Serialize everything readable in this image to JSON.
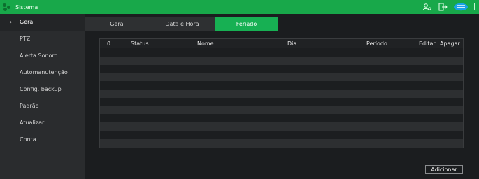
{
  "window": {
    "title": "Sistema"
  },
  "sidebar": {
    "items": [
      {
        "label": "Geral",
        "active": true
      },
      {
        "label": "PTZ",
        "active": false
      },
      {
        "label": "Alerta Sonoro",
        "active": false
      },
      {
        "label": "Automanutenção",
        "active": false
      },
      {
        "label": "Config. backup",
        "active": false
      },
      {
        "label": "Padrão",
        "active": false
      },
      {
        "label": "Atualizar",
        "active": false
      },
      {
        "label": "Conta",
        "active": false
      }
    ],
    "chevron": "›"
  },
  "tabs": [
    {
      "label": "Geral",
      "active": false
    },
    {
      "label": "Data e Hora",
      "active": false
    },
    {
      "label": "Feriado",
      "active": true
    }
  ],
  "table": {
    "columns": [
      "0",
      "Status",
      "Nome",
      "Dia",
      "Período",
      "Editar",
      "Apagar"
    ],
    "rows": []
  },
  "buttons": {
    "add": "Adicionar"
  },
  "colors": {
    "accent": "#17b053",
    "titlebar": "#18a84a",
    "sidebar": "#2a2c2e"
  },
  "icons": [
    "settings-logo-icon",
    "users-icon",
    "logout-icon",
    "storage-icon"
  ]
}
